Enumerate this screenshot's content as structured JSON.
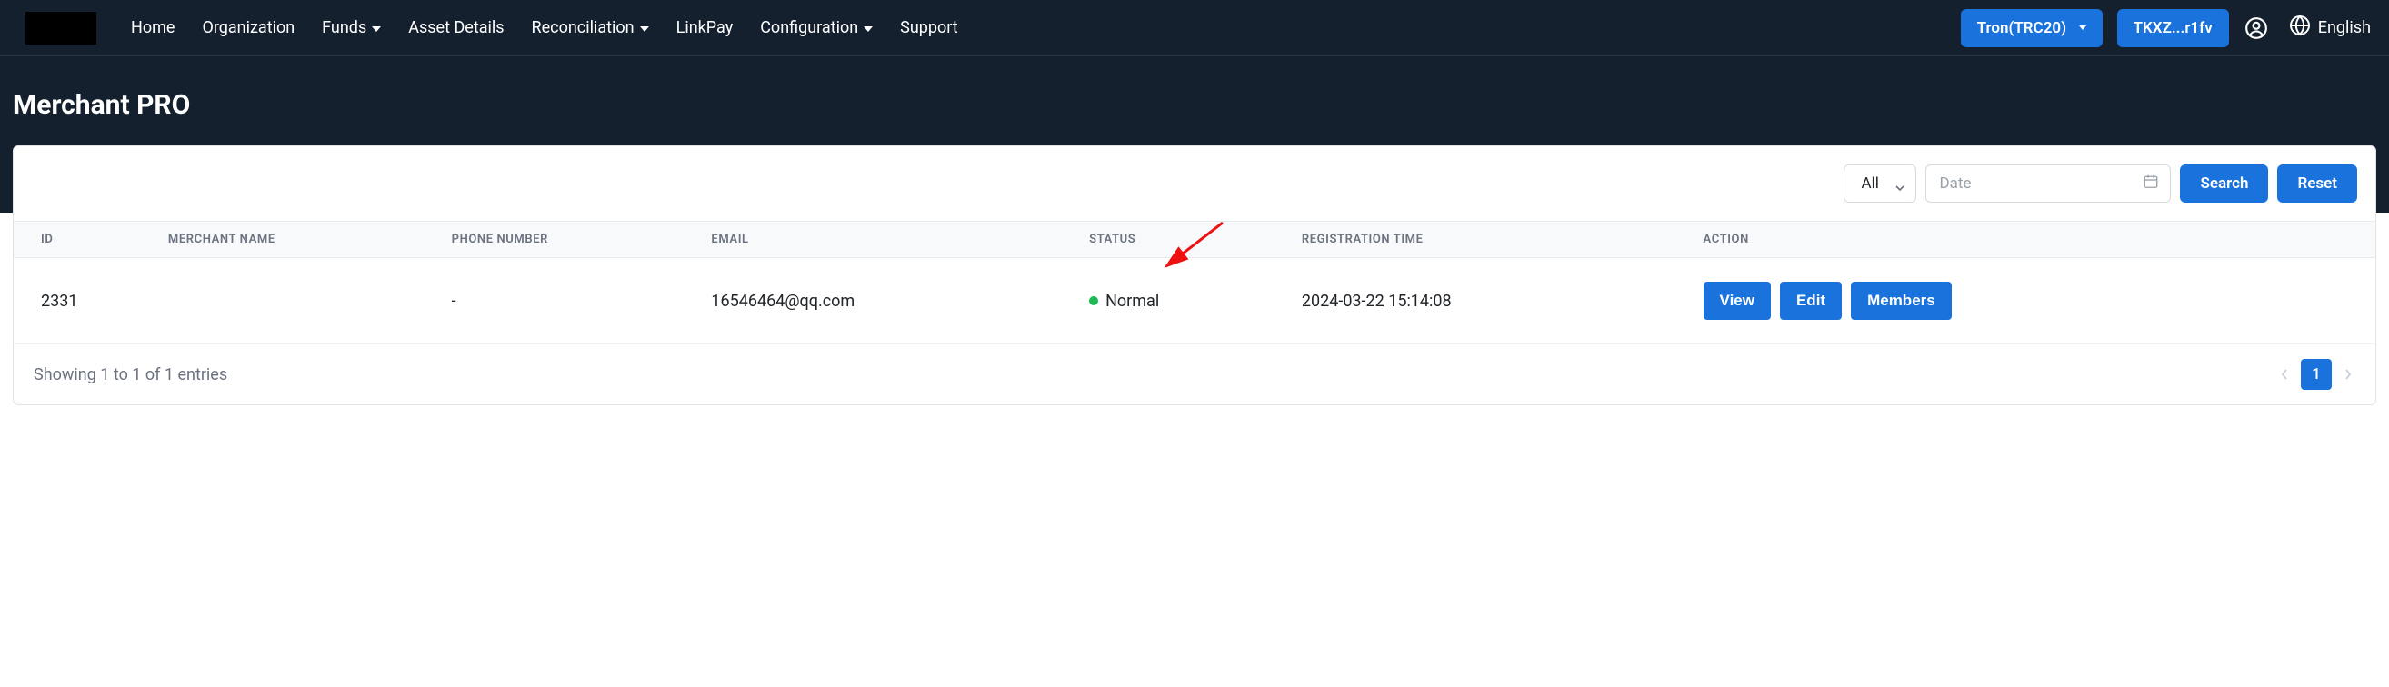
{
  "nav": {
    "home": "Home",
    "organization": "Organization",
    "funds": "Funds",
    "asset_details": "Asset Details",
    "reconciliation": "Reconciliation",
    "linkpay": "LinkPay",
    "configuration": "Configuration",
    "support": "Support"
  },
  "header": {
    "network": "Tron(TRC20)",
    "wallet": "TKXZ...r1fv",
    "language": "English"
  },
  "page": {
    "title": "Merchant PRO"
  },
  "filters": {
    "all": "All",
    "date_placeholder": "Date",
    "search": "Search",
    "reset": "Reset"
  },
  "table": {
    "headers": {
      "id": "ID",
      "merchant_name": "MERCHANT NAME",
      "phone_number": "PHONE NUMBER",
      "email": "EMAIL",
      "status": "STATUS",
      "registration_time": "REGISTRATION TIME",
      "action": "ACTION"
    },
    "rows": [
      {
        "id": "2331",
        "merchant_name": "",
        "phone_number": "-",
        "email": "16546464@qq.com",
        "status_label": "Normal",
        "status_color": "#1db954",
        "registration_time": "2024-03-22 15:14:08"
      }
    ],
    "actions": {
      "view": "View",
      "edit": "Edit",
      "members": "Members"
    }
  },
  "footer": {
    "entries_text": "Showing 1 to 1 of 1 entries",
    "current_page": "1"
  }
}
